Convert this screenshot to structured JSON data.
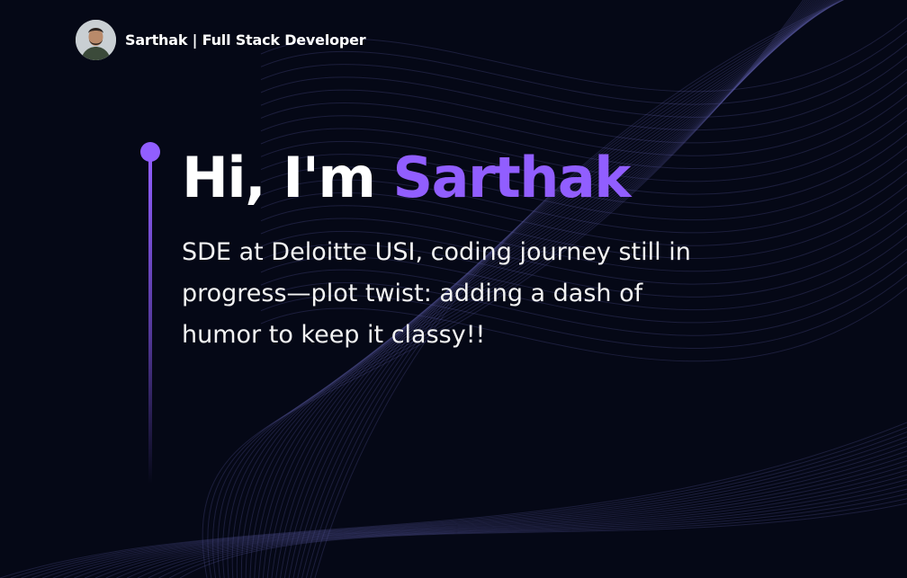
{
  "header": {
    "brand_text": "Sarthak | Full Stack Developer",
    "avatar_icon": "avatar-photo"
  },
  "hero": {
    "greeting": "Hi, I'm ",
    "name": "Sarthak",
    "subtitle": "SDE at Deloitte USI, coding journey still in progress—plot twist: adding a dash of humor to keep it classy!!"
  },
  "colors": {
    "background": "#050816",
    "accent": "#915eff",
    "text": "#ffffff"
  }
}
